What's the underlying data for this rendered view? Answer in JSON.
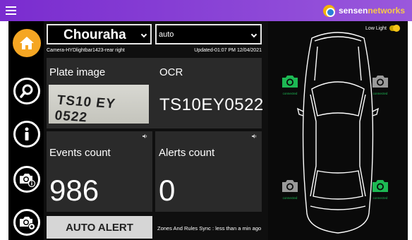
{
  "brand": {
    "name_part1": "sensen",
    "name_part2": "networks"
  },
  "header": {
    "location": "Chouraha",
    "mode": "auto"
  },
  "camera_info": {
    "camera": "Camera-HYDlightbar1423-rear right",
    "updated": "Updated-01:07 PM 12/04/2021"
  },
  "plate": {
    "image_label": "Plate image",
    "ocr_label": "OCR",
    "ocr_value": "TS10EY0522",
    "plate_photo_text": "TS10 EY 0522"
  },
  "events": {
    "label": "Events count",
    "value": "986"
  },
  "alerts": {
    "label": "Alerts count",
    "value": "0"
  },
  "auto_alert_label": "AUTO ALERT",
  "sync_status": "Zones And Rules Sync : less than a min ago",
  "low_light": {
    "label": "Low Light",
    "enabled": true
  },
  "cameras": [
    {
      "position": "front-left",
      "status": "connected",
      "color": "#1db954"
    },
    {
      "position": "front-right",
      "status": "connected",
      "color": "#9a9a9a"
    },
    {
      "position": "rear-left",
      "status": "connected",
      "color": "#9a9a9a"
    },
    {
      "position": "rear-right",
      "status": "connected",
      "color": "#1db954"
    }
  ],
  "colors": {
    "accent_orange": "#f5a623",
    "connected_green": "#1db954",
    "inactive_gray": "#9a9a9a",
    "topbar": "#8a44d6"
  },
  "icons": [
    "menu-icon",
    "home-icon",
    "search-icon",
    "info-icon",
    "camera-info-icon",
    "camera-settings-icon",
    "speaker-icon",
    "camera-icon"
  ]
}
